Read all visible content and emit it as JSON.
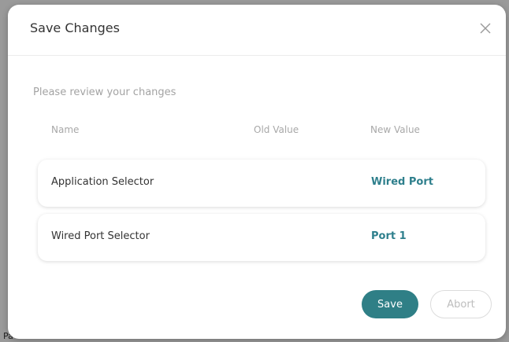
{
  "background": {
    "partial_text": "Pa"
  },
  "dialog": {
    "title": "Save Changes",
    "close_icon": "close-icon",
    "subtitle": "Please review your changes",
    "columns": {
      "name": "Name",
      "old_value": "Old Value",
      "new_value": "New Value"
    },
    "rows": [
      {
        "name": "Application Selector",
        "old_value": "",
        "new_value": "Wired Port"
      },
      {
        "name": "Wired Port Selector",
        "old_value": "",
        "new_value": "Port 1"
      }
    ],
    "buttons": {
      "save": "Save",
      "abort": "Abort"
    }
  },
  "colors": {
    "accent": "#2f7f86",
    "value_text": "#2e7f8c"
  }
}
